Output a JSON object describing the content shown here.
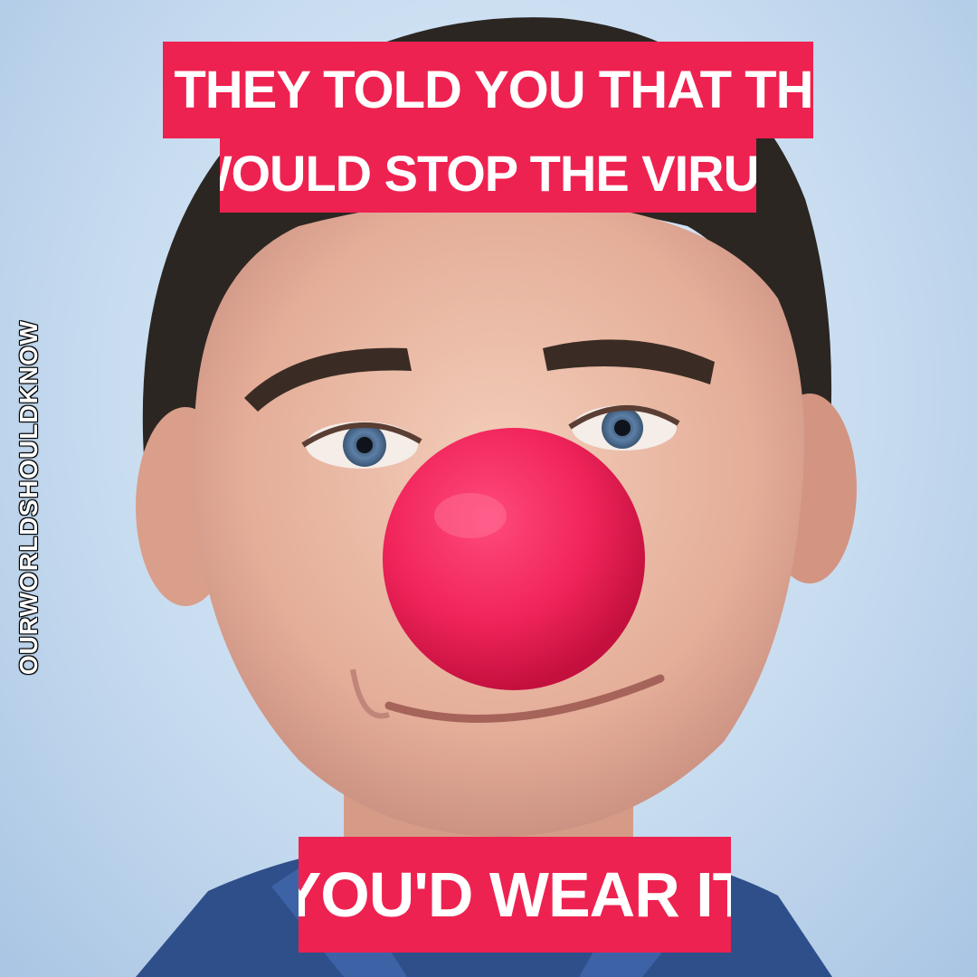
{
  "meme": {
    "caption_line_1": "IF THEY TOLD YOU THAT THIS",
    "caption_line_2": "WOULD STOP THE VIRUS",
    "caption_bottom": "YOU'D WEAR IT",
    "watermark": "OURWORLDSHOULDKNOW"
  },
  "colors": {
    "caption_background": "#ee2250",
    "caption_text": "#ffffff",
    "backdrop": "#c8dcf0",
    "clown_nose": "#f0245a"
  },
  "photo": {
    "subject": "man-wearing-red-clown-nose"
  }
}
